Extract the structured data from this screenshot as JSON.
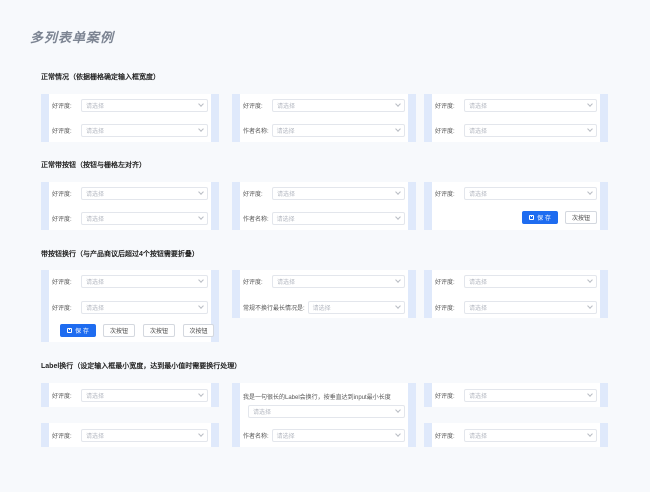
{
  "page": {
    "title": "多列表单案例"
  },
  "labels": {
    "rating": "好评度:",
    "author": "作者名称:",
    "long_nowrap": "常规不换行最长情况是:",
    "long_wrap": "我是一句很长的Label会换行，按垂直达到input最小长度",
    "placeholder": "请选择"
  },
  "sections": {
    "s1": "正常情况（依据栅格确定输入框宽度）",
    "s2": "正常带按钮（按钮与栅格左对齐）",
    "s3": "带按钮换行（与产品商议后超过4个按钮需要折叠）",
    "s4": "Label换行（设定输入框最小宽度，达到最小值时需要换行处理）"
  },
  "buttons": {
    "save": "保 存",
    "secondary": "次按钮"
  },
  "colors": {
    "accent": "#1e6cf0",
    "panel_border": "#dfe9fb"
  }
}
